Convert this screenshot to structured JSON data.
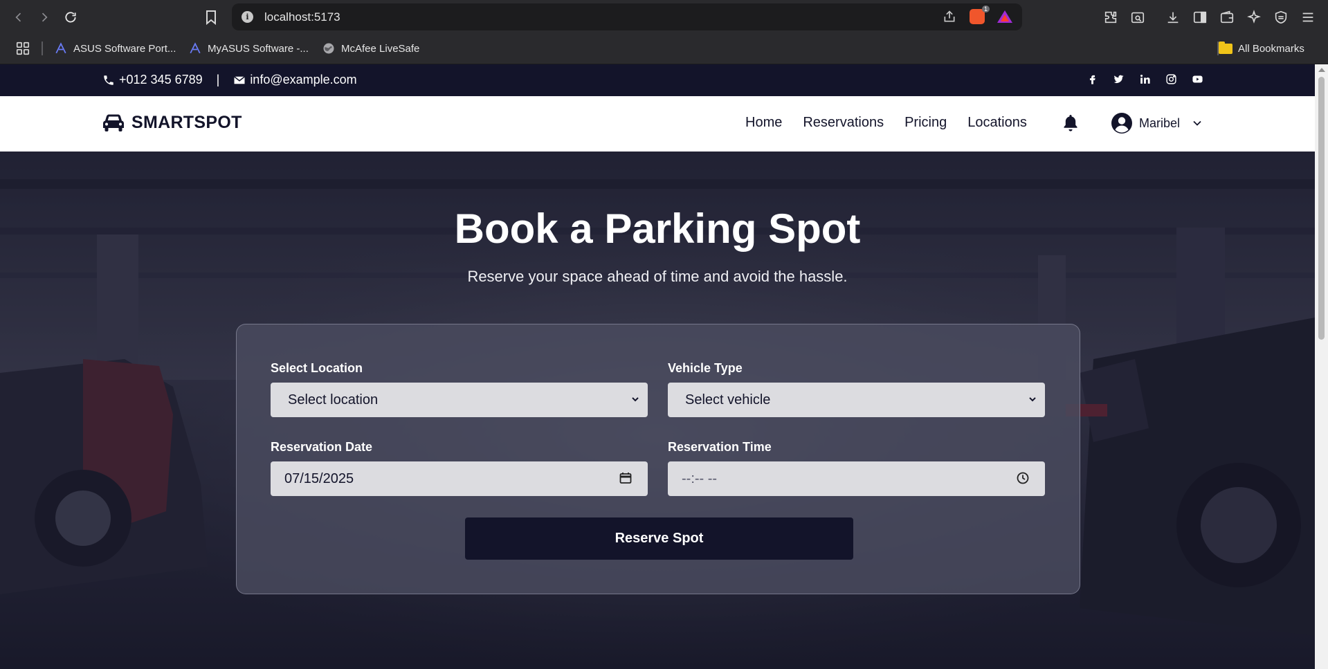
{
  "browser": {
    "url": "localhost:5173",
    "brave_badge_count": "1",
    "bookmarks": [
      {
        "label": "ASUS Software Port...",
        "icon": "asus-icon"
      },
      {
        "label": "MyASUS Software -...",
        "icon": "asus-icon"
      },
      {
        "label": "McAfee LiveSafe",
        "icon": "globe-icon"
      }
    ],
    "all_bookmarks_label": "All Bookmarks"
  },
  "topbar": {
    "phone": "+012 345 6789",
    "divider": "|",
    "email": "info@example.com",
    "socials": [
      "facebook-icon",
      "twitter-icon",
      "linkedin-icon",
      "instagram-icon",
      "youtube-icon"
    ]
  },
  "navbar": {
    "brand": "SMARTSPOT",
    "menu": [
      "Home",
      "Reservations",
      "Pricing",
      "Locations"
    ],
    "user_name": "Maribel"
  },
  "hero": {
    "title": "Book a Parking Spot",
    "subtitle": "Reserve your space ahead of time and avoid the hassle."
  },
  "form": {
    "location_label": "Select Location",
    "location_value": "Select location",
    "vehicle_label": "Vehicle Type",
    "vehicle_value": "Select vehicle",
    "date_label": "Reservation Date",
    "date_value": "07/15/2025",
    "time_label": "Reservation Time",
    "time_value": "--:-- --",
    "submit_label": "Reserve Spot"
  },
  "colors": {
    "navy": "#13142a",
    "field": "#dcdce0",
    "card": "#4b4c5f"
  }
}
